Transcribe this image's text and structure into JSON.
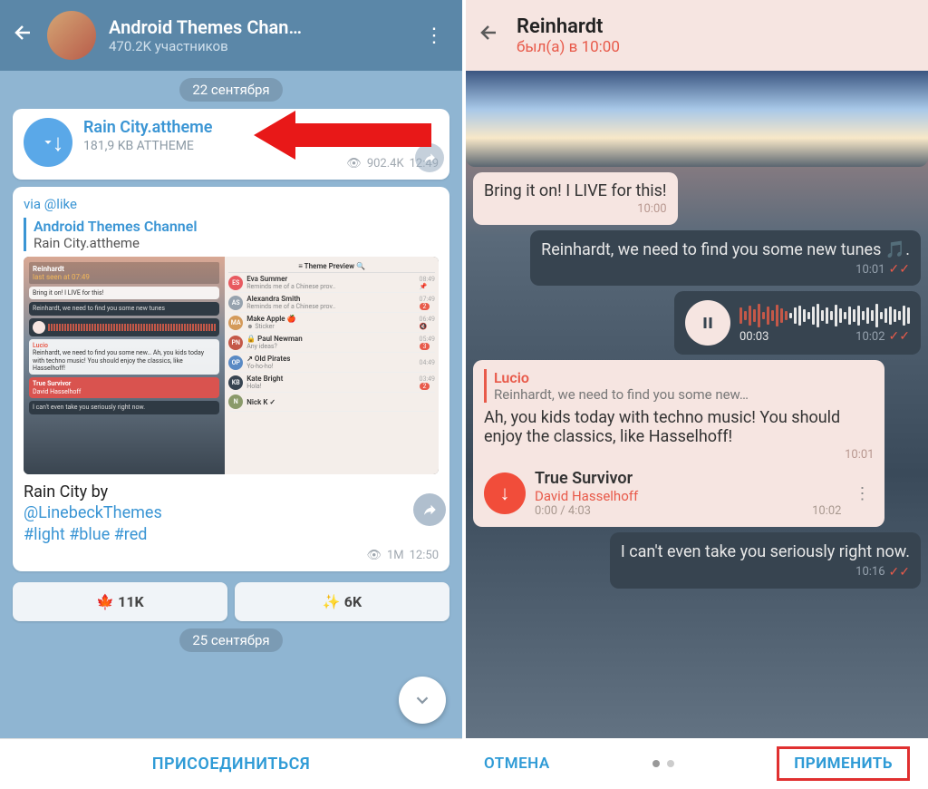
{
  "left": {
    "title": "Android Themes Chan…",
    "subscribers": "470.2K участников",
    "date1": "22 сентября",
    "date2": "25 сентября",
    "file": {
      "name": "Rain City.attheme",
      "meta": "181,9 KB ATTHEME",
      "views": "902.4K",
      "time": "12:49"
    },
    "post": {
      "via": "via @like",
      "reply_title": "Android Themes Channel",
      "reply_sub": "Rain City.attheme",
      "caption": "Rain City by",
      "author": "@LinebeckThemes",
      "tags": "#light #blue #red",
      "views": "1M",
      "time": "12:50"
    },
    "preview": {
      "header": "Theme Preview",
      "left_hdr_name": "Reinhardt",
      "left_hdr_sub": "last seen at 07:49",
      "l1": "Bring it on! I LIVE for this!",
      "l2": "Reinhardt, we need to find you some new tunes",
      "l3_name": "Lucio",
      "l3": "Reinhardt, we need to find you some new… Ah, you kids today with techno music! You should enjoy the classics, like Hasselhoff!",
      "l4_title": "True Survivor",
      "l4_artist": "David Hasselhoff",
      "l5": "I can't even take you seriously right now.",
      "rows": [
        {
          "av": "ES",
          "c": "#e85a60",
          "name": "Eva Summer",
          "msg": "Reminds me of a Chinese prov..",
          "t": "08:49",
          "pin": true
        },
        {
          "av": "AS",
          "c": "#96a2ae",
          "name": "Alexandra Smith",
          "msg": "Reminds me of a Chinese prov..",
          "t": "07:49",
          "badge": "2"
        },
        {
          "av": "MA",
          "c": "#d49a5a",
          "name": "Make Apple 🍎",
          "msg": "☻ Sticker",
          "t": "06:49",
          "mute": true
        },
        {
          "av": "PN",
          "c": "#c45848",
          "name": "🔒 Paul Newman",
          "msg": "Any ideas?",
          "t": "05:49",
          "badge": "3"
        },
        {
          "av": "OP",
          "c": "#5a8ac4",
          "name": "↗ Old Pirates",
          "msg": "Yo-ho-ho!",
          "t": "04:49"
        },
        {
          "av": "KB",
          "c": "#374450",
          "name": "Kate Bright",
          "msg": "Hola!",
          "t": "03:49",
          "badge": "2"
        },
        {
          "av": "N",
          "c": "#8a9a6a",
          "name": "Nick K ✓",
          "msg": "",
          "t": ""
        }
      ]
    },
    "react1": "🍁 11K",
    "react2": "✨ 6K",
    "join": "ПРИСОЕДИНИТЬСЯ"
  },
  "right": {
    "title": "Reinhardt",
    "status": "был(а) в 10:00",
    "msg1": "Bring it on! I LIVE for this!",
    "msg1_time": "10:00",
    "msg2": "Reinhardt, we need to find you some new tunes 🎵.",
    "msg2_time": "10:01",
    "voice_dur": "00:03",
    "voice_time": "10:02",
    "quote_name": "Lucio",
    "quote_txt": "Reinhardt, we need to find you some new…",
    "msg3": "Ah, you kids today with techno music! You should enjoy the classics, like Hasselhoff!",
    "msg3_time": "10:01",
    "audio_title": "True Survivor",
    "audio_artist": "David Hasselhoff",
    "audio_dur": "0:00 / 4:03",
    "audio_time": "10:02",
    "msg4": "I can't even take you seriously right now.",
    "msg4_time": "10:16",
    "cancel": "ОТМЕНА",
    "apply": "ПРИМЕНИТЬ"
  }
}
